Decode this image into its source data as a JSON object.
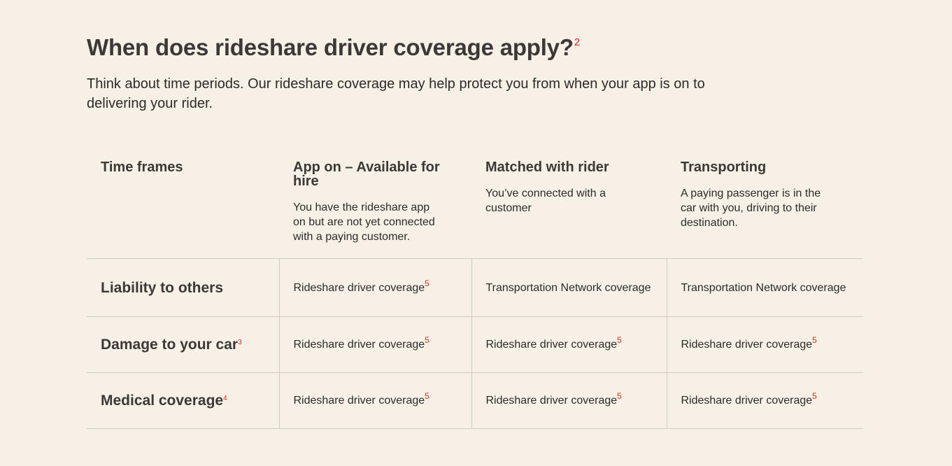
{
  "heading": {
    "title": "When does rideshare driver coverage apply?",
    "footnote": "2"
  },
  "intro": "Think about time periods. Our rideshare coverage may help protect you from when your app is on to delivering your rider.",
  "colors": {
    "background": "#f6f0e6",
    "text": "#3d3836",
    "footnote": "#d42f1f",
    "divider": "#cdcbc6"
  },
  "table": {
    "columns": [
      {
        "title": "Time frames",
        "description": ""
      },
      {
        "title": "App on – Available for hire",
        "description": "You have the rideshare app on but are not yet connected with a paying customer."
      },
      {
        "title": "Matched with rider",
        "description": "You’ve connected with a customer"
      },
      {
        "title": "Transporting",
        "description": "A paying passenger is in the car with you, driving to their destination."
      }
    ],
    "rows": [
      {
        "label": "Liability to others",
        "footnote": "",
        "cells": [
          {
            "text": "Rideshare driver coverage",
            "footnote": "5"
          },
          {
            "text": "Transportation Network coverage",
            "footnote": ""
          },
          {
            "text": "Transportation Network coverage",
            "footnote": ""
          }
        ]
      },
      {
        "label": "Damage to your car",
        "footnote": "3",
        "cells": [
          {
            "text": "Rideshare driver coverage",
            "footnote": "5"
          },
          {
            "text": "Rideshare driver coverage",
            "footnote": "5"
          },
          {
            "text": "Rideshare driver coverage",
            "footnote": "5"
          }
        ]
      },
      {
        "label": "Medical coverage",
        "footnote": "4",
        "cells": [
          {
            "text": "Rideshare driver coverage",
            "footnote": "5"
          },
          {
            "text": "Rideshare driver coverage",
            "footnote": "5"
          },
          {
            "text": "Rideshare driver coverage",
            "footnote": "5"
          }
        ]
      }
    ]
  }
}
